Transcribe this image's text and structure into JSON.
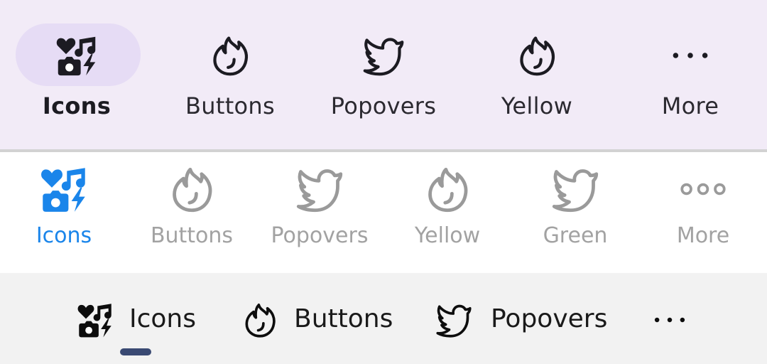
{
  "bar_material": {
    "items": [
      {
        "label": "Icons",
        "icon": "icons-collage-icon",
        "active": true
      },
      {
        "label": "Buttons",
        "icon": "fire-icon",
        "active": false
      },
      {
        "label": "Popovers",
        "icon": "twitter-bird-icon",
        "active": false
      },
      {
        "label": "Yellow",
        "icon": "fire-icon",
        "active": false
      },
      {
        "label": "More",
        "icon": "more-dots-icon",
        "active": false
      }
    ],
    "background": "#f2ebf7",
    "active_pill": "#e6dcf5"
  },
  "bar_ios": {
    "items": [
      {
        "label": "Icons",
        "icon": "icons-collage-icon",
        "active": true
      },
      {
        "label": "Buttons",
        "icon": "fire-outline-icon",
        "active": false
      },
      {
        "label": "Popovers",
        "icon": "twitter-bird-outline-icon",
        "active": false
      },
      {
        "label": "Yellow",
        "icon": "fire-outline-icon",
        "active": false
      },
      {
        "label": "Green",
        "icon": "twitter-bird-outline-icon",
        "active": false
      },
      {
        "label": "More",
        "icon": "more-circles-icon",
        "active": false
      }
    ],
    "active_color": "#1a85ea",
    "inactive_color": "#9a9a9a"
  },
  "bar_tabs": {
    "items": [
      {
        "label": "Icons",
        "icon": "icons-collage-icon",
        "active": true
      },
      {
        "label": "Buttons",
        "icon": "fire-icon",
        "active": false
      },
      {
        "label": "Popovers",
        "icon": "twitter-bird-icon",
        "active": false
      },
      {
        "label": "",
        "icon": "more-dots-icon",
        "active": false
      }
    ],
    "indicator_color": "#3a4a73"
  }
}
